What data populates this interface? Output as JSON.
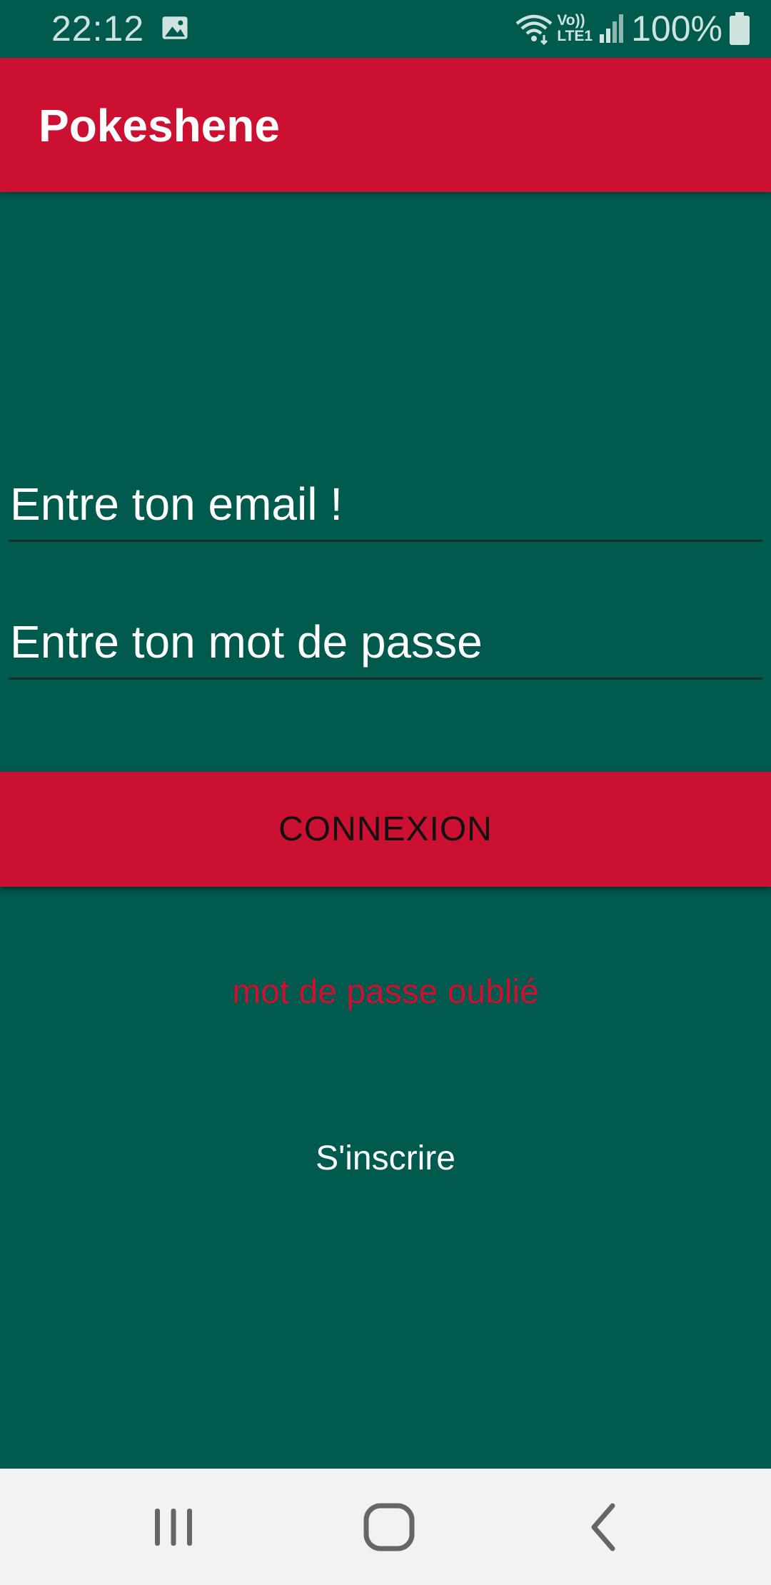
{
  "status_bar": {
    "time": "22:12",
    "network_label_top": "Vo))",
    "network_label_bottom": "LTE1",
    "battery": "100%",
    "icons": [
      "gallery-icon",
      "wifi-icon",
      "signal-icon",
      "battery-icon"
    ]
  },
  "app_bar": {
    "title": "Pokeshene",
    "color": "#cb1032"
  },
  "form": {
    "email_placeholder": "Entre ton email !",
    "email_value": "",
    "password_placeholder": "Entre ton mot de passe",
    "password_value": "",
    "login_label": "CONNEXION",
    "forgot_label": "mot de passe oublié",
    "signup_label": "S'inscrire"
  },
  "nav_bar": {
    "icons": [
      "recents-icon",
      "home-icon",
      "back-icon"
    ]
  },
  "colors": {
    "background": "#015a4e",
    "accent": "#cb1032",
    "text": "#ffffff"
  }
}
